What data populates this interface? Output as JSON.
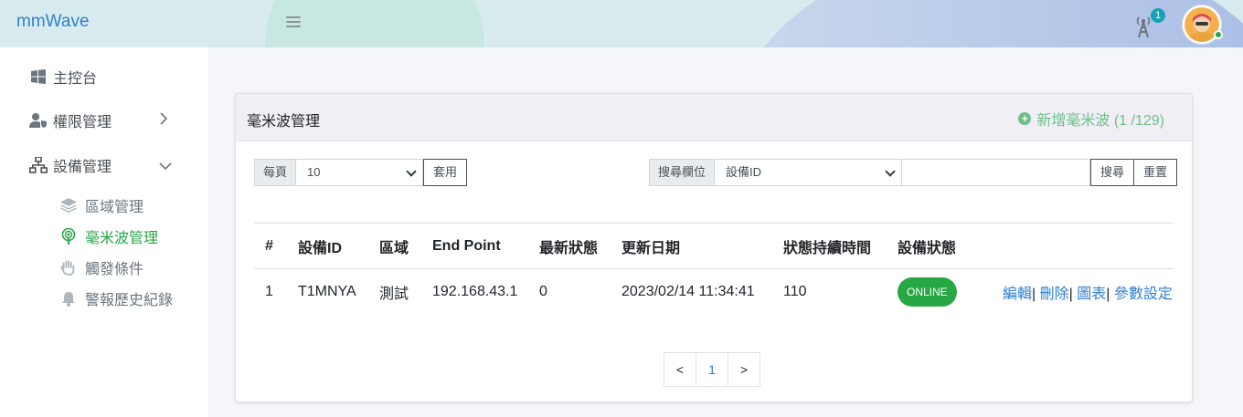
{
  "header": {
    "brand": "mmWave",
    "notification_count": "1"
  },
  "sidebar": {
    "items": [
      {
        "label": "主控台",
        "icon": "windows-icon"
      },
      {
        "label": "權限管理",
        "icon": "user-shield-icon"
      },
      {
        "label": "設備管理",
        "icon": "network-icon"
      }
    ],
    "subitems": [
      {
        "label": "區域管理",
        "icon": "layers-icon"
      },
      {
        "label": "毫米波管理",
        "icon": "podcast-icon"
      },
      {
        "label": "觸發條件",
        "icon": "hand-icon"
      },
      {
        "label": "警報歷史紀錄",
        "icon": "bell-icon"
      }
    ]
  },
  "card": {
    "title": "毫米波管理",
    "add_label": "新增毫米波 (1 /129)"
  },
  "filters": {
    "per_page_label": "每頁",
    "per_page_value": "10",
    "apply_label": "套用",
    "search_field_label": "搜尋欄位",
    "search_field_value": "設備ID",
    "search_value": "",
    "search_label": "搜尋",
    "reset_label": "重置"
  },
  "table": {
    "columns": [
      "#",
      "設備ID",
      "區域",
      "End Point",
      "最新狀態",
      "更新日期",
      "狀態持續時間",
      "設備狀態",
      ""
    ],
    "rows": [
      {
        "index": "1",
        "device_id": "T1MNYA",
        "area": "測試",
        "endpoint": "192.168.43.1",
        "latest_status": "0",
        "updated": "2023/02/14 11:34:41",
        "duration": "110",
        "device_status": "ONLINE",
        "actions": [
          "編輯",
          "刪除",
          "圖表",
          "參數設定"
        ]
      }
    ]
  },
  "pagination": {
    "prev": "<",
    "current": "1",
    "next": ">"
  },
  "colors": {
    "accent": "#2f7fd1",
    "success": "#28a745",
    "add_button": "#6cc08a"
  }
}
